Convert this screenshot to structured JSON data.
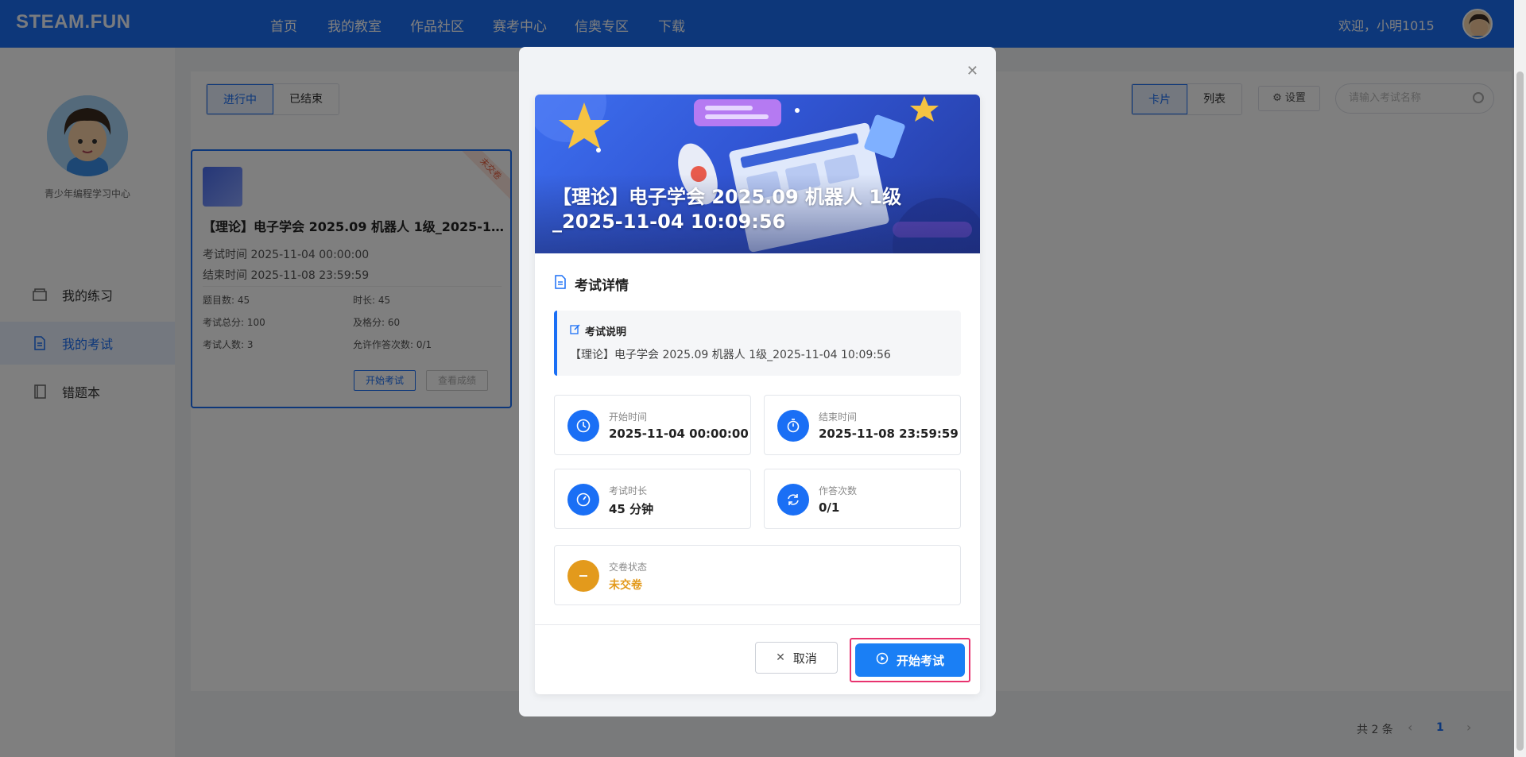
{
  "app": {
    "logo": "STEAM.FUN",
    "welcome": "欢迎，小明1015"
  },
  "nav": [
    "首页",
    "我的教室",
    "作品社区",
    "赛考中心",
    "信奥专区",
    "下载"
  ],
  "sidebar": {
    "school": "青少年编程学习中心",
    "items": [
      {
        "label": "我的练习",
        "icon": "box-icon"
      },
      {
        "label": "我的考试",
        "icon": "document-icon"
      },
      {
        "label": "错题本",
        "icon": "notebook-icon"
      }
    ]
  },
  "filters": {
    "status_tabs": [
      "进行中",
      "已结束"
    ],
    "view_tabs": [
      "卡片",
      "列表"
    ],
    "settings": "设置",
    "search_placeholder": "请输入考试名称"
  },
  "card": {
    "ribbon": "未交卷",
    "title": "【理论】电子学会 2025.09 机器人 1级_2025-11...",
    "start_time": "考试时间 2025-11-04 00:00:00",
    "end_time": "结束时间 2025-11-08 23:59:59",
    "questions": "题目数: 45",
    "duration": "时长: 45",
    "total_score": "考试总分: 100",
    "pass_score": "及格分: 60",
    "people": "考试人数: 3",
    "attempts": "允许作答次数: 0/1",
    "btn_start": "开始考试",
    "btn_view": "查看成绩"
  },
  "pagination": {
    "total": "共 2 条",
    "current": "1"
  },
  "modal": {
    "banner_title": "【理论】电子学会 2025.09 机器人 1级_2025-11-04 10:09:56",
    "section_title": "考试详情",
    "desc_title": "考试说明",
    "desc_text": "【理论】电子学会 2025.09 机器人 1级_2025-11-04 10:09:56",
    "start_label": "开始时间",
    "start_value": "2025-11-04 00:00:00",
    "end_label": "结束时间",
    "end_value": "2025-11-08 23:59:59",
    "duration_label": "考试时长",
    "duration_value": "45 分钟",
    "attempts_label": "作答次数",
    "attempts_value": "0/1",
    "submit_label": "交卷状态",
    "submit_value": "未交卷",
    "cancel": "取消",
    "start": "开始考试"
  },
  "colors": {
    "primary": "#1a6ff5",
    "warning": "#e39a1c",
    "highlight": "#e8336f"
  }
}
